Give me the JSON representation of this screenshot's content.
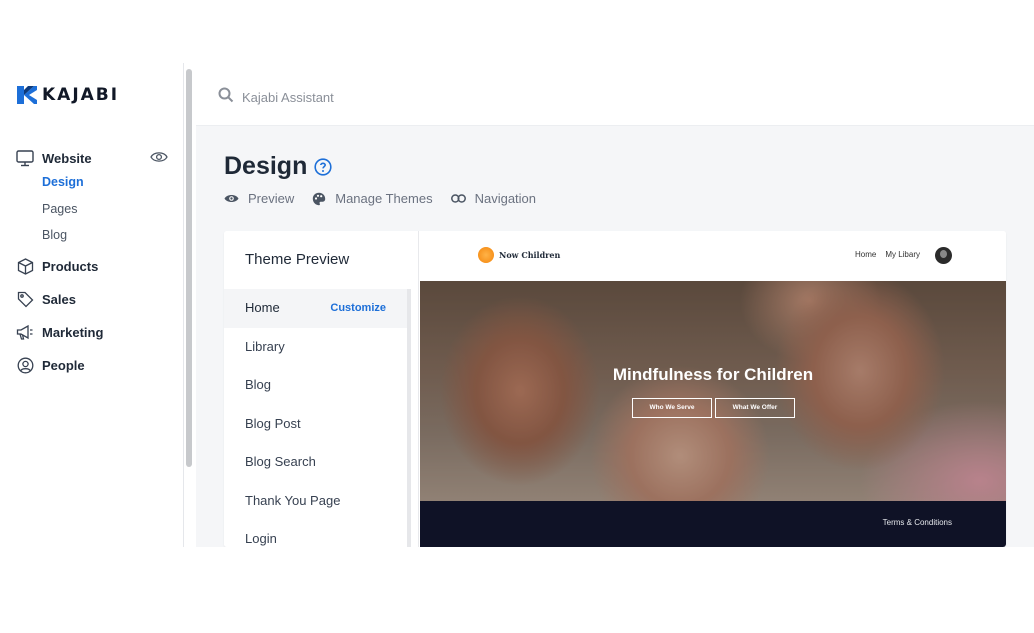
{
  "brand": {
    "logo_text": "KAJABI",
    "accent": "#1d6fd8"
  },
  "sidebar": {
    "website": {
      "label": "Website",
      "subitems": [
        {
          "label": "Design",
          "active": true
        },
        {
          "label": "Pages",
          "active": false
        },
        {
          "label": "Blog",
          "active": false
        }
      ]
    },
    "items": [
      {
        "label": "Products",
        "icon": "box-icon"
      },
      {
        "label": "Sales",
        "icon": "tag-icon"
      },
      {
        "label": "Marketing",
        "icon": "megaphone-icon"
      },
      {
        "label": "People",
        "icon": "person-circle-icon"
      }
    ]
  },
  "search": {
    "label": "Kajabi Assistant"
  },
  "page": {
    "title": "Design",
    "actions": [
      {
        "label": "Preview",
        "icon": "eye-icon"
      },
      {
        "label": "Manage Themes",
        "icon": "palette-icon"
      },
      {
        "label": "Navigation",
        "icon": "link-icon"
      }
    ]
  },
  "theme_preview": {
    "title": "Theme Preview",
    "customize_label": "Customize",
    "pages": [
      "Home",
      "Library",
      "Blog",
      "Blog Post",
      "Blog Search",
      "Thank You Page",
      "Login"
    ]
  },
  "site_preview": {
    "logo_name": "Now Children",
    "nav": [
      "Home",
      "My Libary"
    ],
    "hero_title": "Mindfulness for Children",
    "hero_buttons": [
      "Who We Serve",
      "What We Offer"
    ],
    "footer_link": "Terms & Conditions",
    "footer_color": "#0f1226"
  }
}
